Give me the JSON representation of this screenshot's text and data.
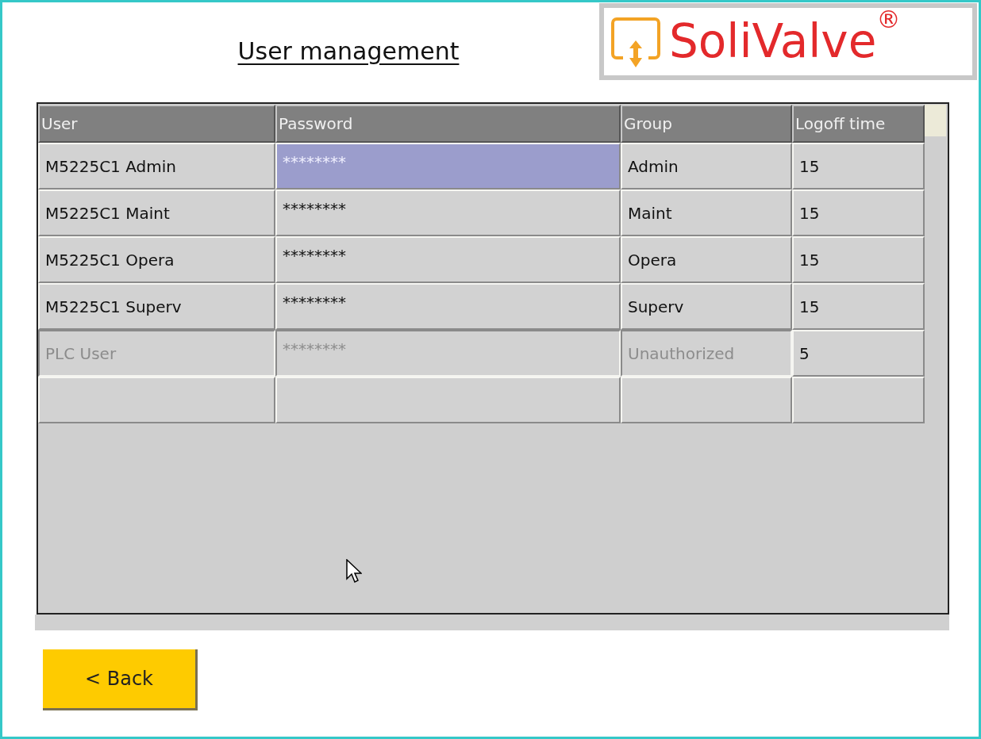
{
  "title": "User management",
  "logo": {
    "text": "SoliValve$^{®}$"
  },
  "table": {
    "columns": [
      "User",
      "Password",
      "Group",
      "Logoff time"
    ],
    "rows": [
      {
        "kind": "entry",
        "selected": true,
        "disabled": false,
        "cells": [
          "M5225C1 Admin",
          "********",
          "Admin",
          "15"
        ]
      },
      {
        "kind": "entry",
        "selected": false,
        "disabled": false,
        "cells": [
          "M5225C1 Maint",
          "********",
          "Maint",
          "15"
        ]
      },
      {
        "kind": "entry",
        "selected": false,
        "disabled": false,
        "cells": [
          "M5225C1 Opera",
          "********",
          "Opera",
          "15"
        ]
      },
      {
        "kind": "entry",
        "selected": false,
        "disabled": false,
        "cells": [
          "M5225C1 Superv",
          "********",
          "Superv",
          "15"
        ]
      },
      {
        "kind": "entry",
        "selected": false,
        "disabled": true,
        "cells": [
          "PLC User",
          "********",
          "Unauthorized",
          "5"
        ]
      },
      {
        "kind": "blank"
      }
    ]
  },
  "back_button": {
    "label": "< Back"
  }
}
